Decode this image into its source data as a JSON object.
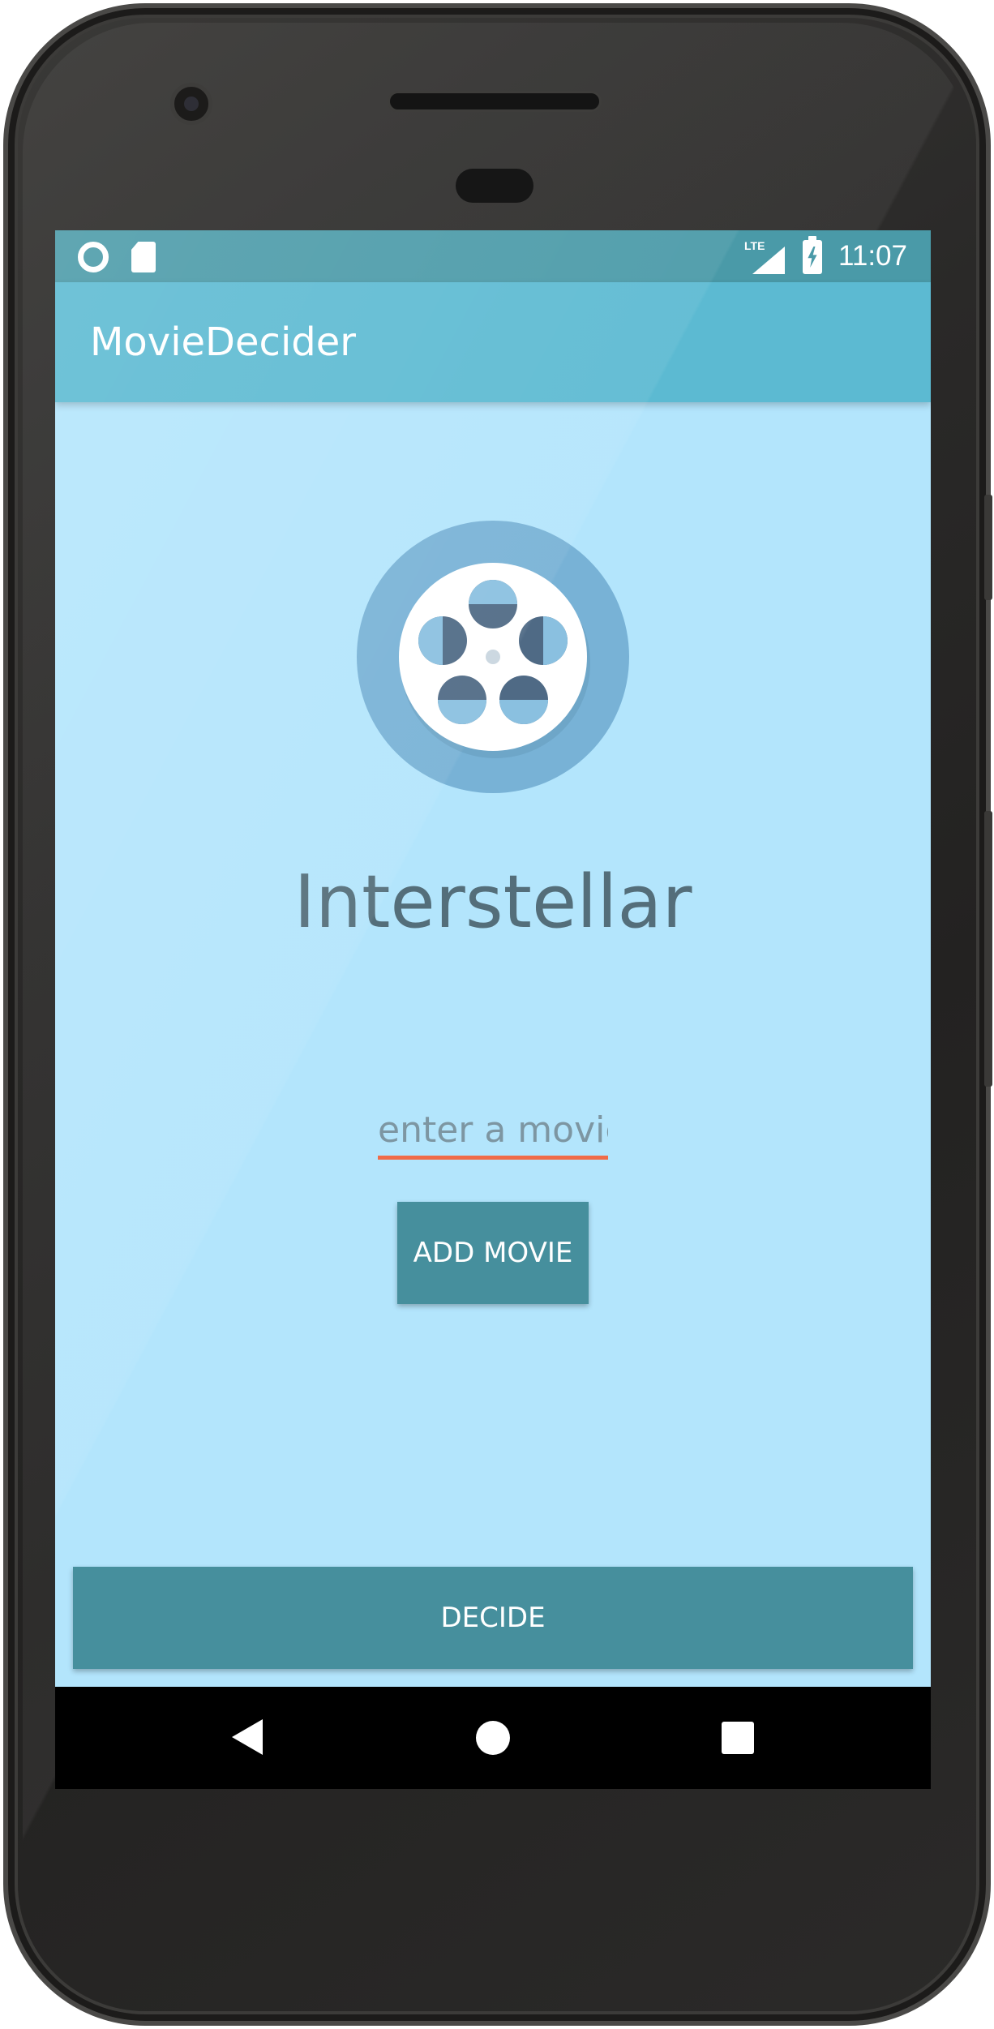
{
  "status_bar": {
    "time": "11:07",
    "network_label": "LTE",
    "icons": [
      "sync-circle-icon",
      "sd-card-icon",
      "lte-signal-icon",
      "battery-charging-icon"
    ]
  },
  "app_bar": {
    "title": "MovieDecider"
  },
  "main": {
    "logo_icon": "film-reel-icon",
    "selected_movie": "Interstellar",
    "movie_input": {
      "value": "",
      "placeholder": "enter a movie"
    },
    "add_button_label": "ADD MOVIE",
    "decide_button_label": "DECIDE"
  },
  "nav_bar": {
    "icons": [
      "back-icon",
      "home-icon",
      "recents-icon"
    ]
  },
  "colors": {
    "status_bar": "#4a9aa8",
    "app_bar": "#5cbad2",
    "background": "#b3e5fc",
    "button": "#468f9d",
    "input_underline": "#f06b48",
    "title_text": "#546e7a"
  }
}
